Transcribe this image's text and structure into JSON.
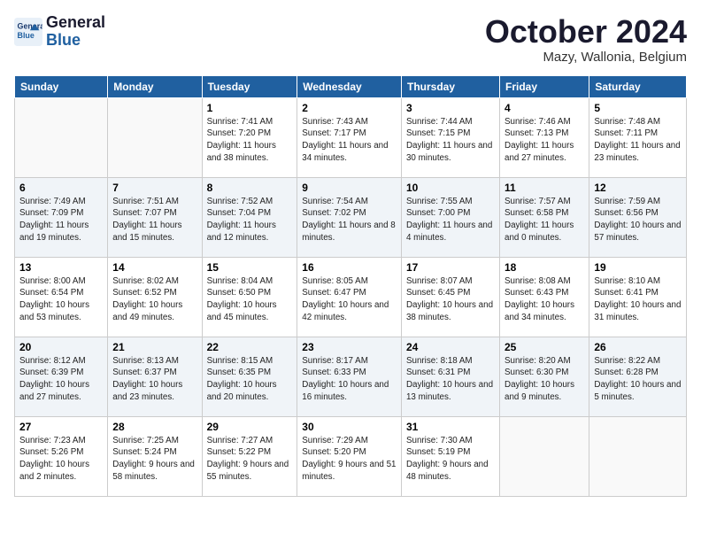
{
  "header": {
    "logo_line1": "General",
    "logo_line2": "Blue",
    "month_title": "October 2024",
    "location": "Mazy, Wallonia, Belgium"
  },
  "days_of_week": [
    "Sunday",
    "Monday",
    "Tuesday",
    "Wednesday",
    "Thursday",
    "Friday",
    "Saturday"
  ],
  "weeks": [
    [
      {
        "day": "",
        "sunrise": "",
        "sunset": "",
        "daylight": ""
      },
      {
        "day": "",
        "sunrise": "",
        "sunset": "",
        "daylight": ""
      },
      {
        "day": "1",
        "sunrise": "Sunrise: 7:41 AM",
        "sunset": "Sunset: 7:20 PM",
        "daylight": "Daylight: 11 hours and 38 minutes."
      },
      {
        "day": "2",
        "sunrise": "Sunrise: 7:43 AM",
        "sunset": "Sunset: 7:17 PM",
        "daylight": "Daylight: 11 hours and 34 minutes."
      },
      {
        "day": "3",
        "sunrise": "Sunrise: 7:44 AM",
        "sunset": "Sunset: 7:15 PM",
        "daylight": "Daylight: 11 hours and 30 minutes."
      },
      {
        "day": "4",
        "sunrise": "Sunrise: 7:46 AM",
        "sunset": "Sunset: 7:13 PM",
        "daylight": "Daylight: 11 hours and 27 minutes."
      },
      {
        "day": "5",
        "sunrise": "Sunrise: 7:48 AM",
        "sunset": "Sunset: 7:11 PM",
        "daylight": "Daylight: 11 hours and 23 minutes."
      }
    ],
    [
      {
        "day": "6",
        "sunrise": "Sunrise: 7:49 AM",
        "sunset": "Sunset: 7:09 PM",
        "daylight": "Daylight: 11 hours and 19 minutes."
      },
      {
        "day": "7",
        "sunrise": "Sunrise: 7:51 AM",
        "sunset": "Sunset: 7:07 PM",
        "daylight": "Daylight: 11 hours and 15 minutes."
      },
      {
        "day": "8",
        "sunrise": "Sunrise: 7:52 AM",
        "sunset": "Sunset: 7:04 PM",
        "daylight": "Daylight: 11 hours and 12 minutes."
      },
      {
        "day": "9",
        "sunrise": "Sunrise: 7:54 AM",
        "sunset": "Sunset: 7:02 PM",
        "daylight": "Daylight: 11 hours and 8 minutes."
      },
      {
        "day": "10",
        "sunrise": "Sunrise: 7:55 AM",
        "sunset": "Sunset: 7:00 PM",
        "daylight": "Daylight: 11 hours and 4 minutes."
      },
      {
        "day": "11",
        "sunrise": "Sunrise: 7:57 AM",
        "sunset": "Sunset: 6:58 PM",
        "daylight": "Daylight: 11 hours and 0 minutes."
      },
      {
        "day": "12",
        "sunrise": "Sunrise: 7:59 AM",
        "sunset": "Sunset: 6:56 PM",
        "daylight": "Daylight: 10 hours and 57 minutes."
      }
    ],
    [
      {
        "day": "13",
        "sunrise": "Sunrise: 8:00 AM",
        "sunset": "Sunset: 6:54 PM",
        "daylight": "Daylight: 10 hours and 53 minutes."
      },
      {
        "day": "14",
        "sunrise": "Sunrise: 8:02 AM",
        "sunset": "Sunset: 6:52 PM",
        "daylight": "Daylight: 10 hours and 49 minutes."
      },
      {
        "day": "15",
        "sunrise": "Sunrise: 8:04 AM",
        "sunset": "Sunset: 6:50 PM",
        "daylight": "Daylight: 10 hours and 45 minutes."
      },
      {
        "day": "16",
        "sunrise": "Sunrise: 8:05 AM",
        "sunset": "Sunset: 6:47 PM",
        "daylight": "Daylight: 10 hours and 42 minutes."
      },
      {
        "day": "17",
        "sunrise": "Sunrise: 8:07 AM",
        "sunset": "Sunset: 6:45 PM",
        "daylight": "Daylight: 10 hours and 38 minutes."
      },
      {
        "day": "18",
        "sunrise": "Sunrise: 8:08 AM",
        "sunset": "Sunset: 6:43 PM",
        "daylight": "Daylight: 10 hours and 34 minutes."
      },
      {
        "day": "19",
        "sunrise": "Sunrise: 8:10 AM",
        "sunset": "Sunset: 6:41 PM",
        "daylight": "Daylight: 10 hours and 31 minutes."
      }
    ],
    [
      {
        "day": "20",
        "sunrise": "Sunrise: 8:12 AM",
        "sunset": "Sunset: 6:39 PM",
        "daylight": "Daylight: 10 hours and 27 minutes."
      },
      {
        "day": "21",
        "sunrise": "Sunrise: 8:13 AM",
        "sunset": "Sunset: 6:37 PM",
        "daylight": "Daylight: 10 hours and 23 minutes."
      },
      {
        "day": "22",
        "sunrise": "Sunrise: 8:15 AM",
        "sunset": "Sunset: 6:35 PM",
        "daylight": "Daylight: 10 hours and 20 minutes."
      },
      {
        "day": "23",
        "sunrise": "Sunrise: 8:17 AM",
        "sunset": "Sunset: 6:33 PM",
        "daylight": "Daylight: 10 hours and 16 minutes."
      },
      {
        "day": "24",
        "sunrise": "Sunrise: 8:18 AM",
        "sunset": "Sunset: 6:31 PM",
        "daylight": "Daylight: 10 hours and 13 minutes."
      },
      {
        "day": "25",
        "sunrise": "Sunrise: 8:20 AM",
        "sunset": "Sunset: 6:30 PM",
        "daylight": "Daylight: 10 hours and 9 minutes."
      },
      {
        "day": "26",
        "sunrise": "Sunrise: 8:22 AM",
        "sunset": "Sunset: 6:28 PM",
        "daylight": "Daylight: 10 hours and 5 minutes."
      }
    ],
    [
      {
        "day": "27",
        "sunrise": "Sunrise: 7:23 AM",
        "sunset": "Sunset: 5:26 PM",
        "daylight": "Daylight: 10 hours and 2 minutes."
      },
      {
        "day": "28",
        "sunrise": "Sunrise: 7:25 AM",
        "sunset": "Sunset: 5:24 PM",
        "daylight": "Daylight: 9 hours and 58 minutes."
      },
      {
        "day": "29",
        "sunrise": "Sunrise: 7:27 AM",
        "sunset": "Sunset: 5:22 PM",
        "daylight": "Daylight: 9 hours and 55 minutes."
      },
      {
        "day": "30",
        "sunrise": "Sunrise: 7:29 AM",
        "sunset": "Sunset: 5:20 PM",
        "daylight": "Daylight: 9 hours and 51 minutes."
      },
      {
        "day": "31",
        "sunrise": "Sunrise: 7:30 AM",
        "sunset": "Sunset: 5:19 PM",
        "daylight": "Daylight: 9 hours and 48 minutes."
      },
      {
        "day": "",
        "sunrise": "",
        "sunset": "",
        "daylight": ""
      },
      {
        "day": "",
        "sunrise": "",
        "sunset": "",
        "daylight": ""
      }
    ]
  ]
}
